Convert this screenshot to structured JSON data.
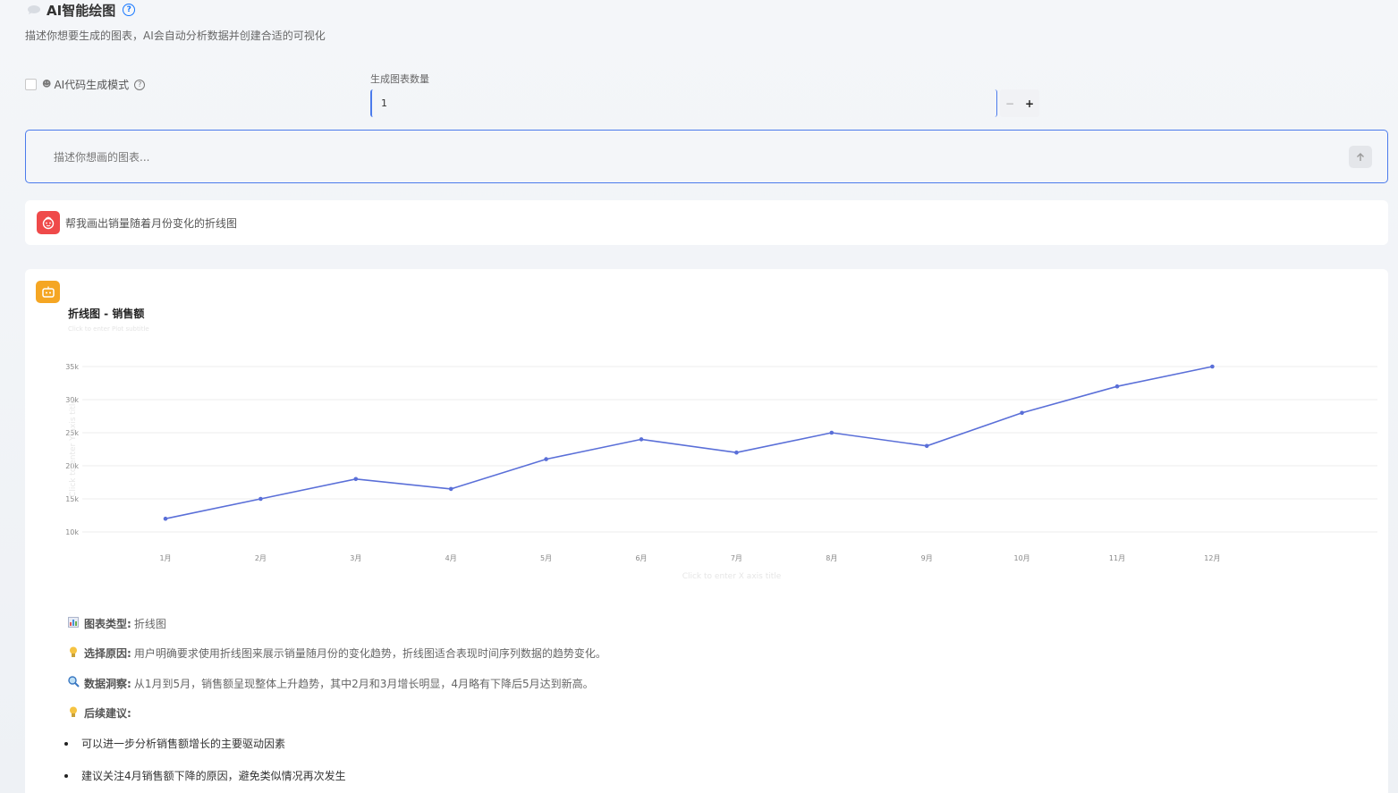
{
  "header": {
    "title": "AI智能绘图",
    "subtitle": "描述你想要生成的图表，AI会自动分析数据并创建合适的可视化"
  },
  "options": {
    "code_mode_label": "AI代码生成模式",
    "count_label": "生成图表数量",
    "count_value": "1",
    "minus": "−",
    "plus": "+"
  },
  "prompt": {
    "placeholder": "描述你想画的图表..."
  },
  "user_message": {
    "text": "帮我画出销量随着月份变化的折线图"
  },
  "ai_response": {
    "analysis": {
      "type_key": "图表类型:",
      "type_val": "折线图",
      "reason_key": "选择原因:",
      "reason_val": "用户明确要求使用折线图来展示销量随月份的变化趋势，折线图适合表现时间序列数据的趋势变化。",
      "insight_key": "数据洞察:",
      "insight_val": "从1月到5月，销售额呈现整体上升趋势，其中2月和3月增长明显，4月略有下降后5月达到新高。",
      "suggest_key": "后续建议:",
      "suggestions": [
        "可以进一步分析销售额增长的主要驱动因素",
        "建议关注4月销售额下降的原因，避免类似情况再次发生"
      ]
    }
  },
  "chart_data": {
    "type": "line",
    "title": "折线图 - 销售额",
    "subtitle": "Click to enter Plot subtitle",
    "xlabel": "Click to enter X axis title",
    "ylabel": "Click to enter Y axis title",
    "categories": [
      "1月",
      "2月",
      "3月",
      "4月",
      "5月",
      "6月",
      "7月",
      "8月",
      "9月",
      "10月",
      "11月",
      "12月"
    ],
    "series": [
      {
        "values": [
          12000,
          15000,
          18000,
          16500,
          21000,
          24000,
          22000,
          25000,
          23000,
          28000,
          32000,
          35000
        ]
      }
    ],
    "yticks": [
      "10k",
      "15k",
      "20k",
      "25k",
      "30k",
      "35k"
    ],
    "ylim": [
      10000,
      35000
    ],
    "grid": true,
    "color": "#5a6fd8"
  }
}
